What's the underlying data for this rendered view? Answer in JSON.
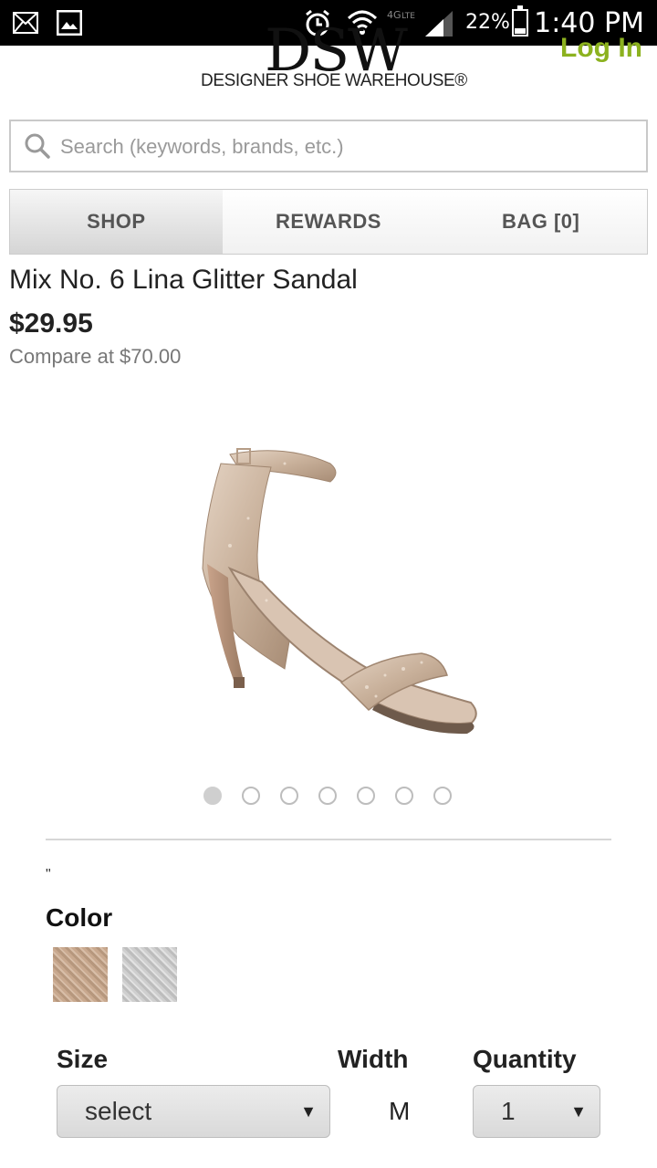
{
  "status_bar": {
    "battery_percent": "22%",
    "time": "1:40 PM"
  },
  "header": {
    "logo_mark": "DSW",
    "logo_subtitle": "DESIGNER SHOE WAREHOUSE®",
    "login_label": "Log In"
  },
  "search": {
    "placeholder": "Search (keywords, brands, etc.)"
  },
  "nav_tabs": [
    {
      "label": "SHOP",
      "active": true
    },
    {
      "label": "REWARDS",
      "active": false
    },
    {
      "label": "BAG [0]",
      "active": false
    }
  ],
  "product": {
    "name": "Mix No. 6 Lina Glitter Sandal",
    "price": "$29.95",
    "compare_price": "Compare at $70.00",
    "image_count": 7,
    "active_image_index": 0
  },
  "options": {
    "quote_mark": "\"",
    "color_label": "Color",
    "colors": [
      "gold",
      "silver"
    ],
    "size_label": "Size",
    "size_value": "select",
    "width_label": "Width",
    "width_value": "M",
    "quantity_label": "Quantity",
    "quantity_value": "1"
  }
}
